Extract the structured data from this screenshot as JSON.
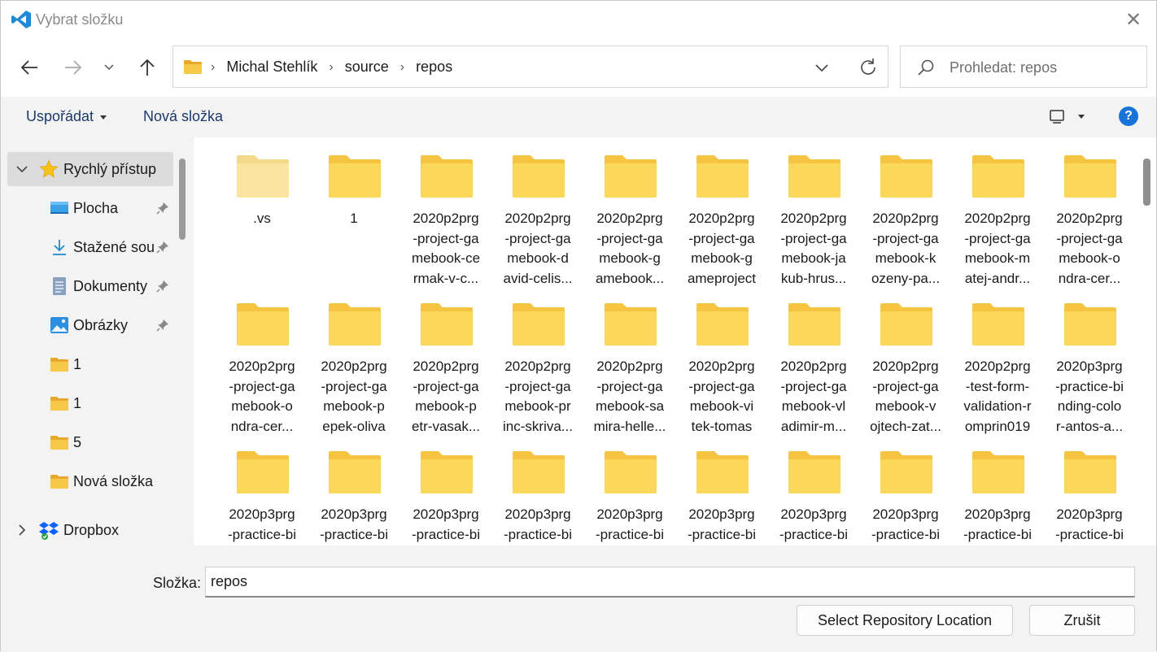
{
  "window": {
    "title": "Vybrat složku",
    "close_label": "✕"
  },
  "nav": {
    "breadcrumbs": [
      "Michal Stehlík",
      "source",
      "repos"
    ],
    "search_placeholder": "Prohledat: repos"
  },
  "toolbar": {
    "organize_label": "Uspořádat",
    "new_folder_label": "Nová složka",
    "help_label": "?"
  },
  "sidebar": {
    "items": [
      {
        "label": "Rychlý přístup",
        "icon": "star-icon",
        "pinned": false
      },
      {
        "label": "Plocha",
        "icon": "desktop-icon",
        "pinned": true
      },
      {
        "label": "Stažené soubory",
        "icon": "download-icon",
        "pinned": true
      },
      {
        "label": "Dokumenty",
        "icon": "document-icon",
        "pinned": true
      },
      {
        "label": "Obrázky",
        "icon": "pictures-icon",
        "pinned": true
      },
      {
        "label": "1",
        "icon": "folder-icon",
        "pinned": false
      },
      {
        "label": "1",
        "icon": "folder-icon",
        "pinned": false
      },
      {
        "label": "5",
        "icon": "folder-icon",
        "pinned": false
      },
      {
        "label": "Nová složka",
        "icon": "folder-icon",
        "pinned": false
      },
      {
        "label": "Dropbox",
        "icon": "dropbox-icon",
        "pinned": false
      }
    ]
  },
  "folders": [
    {
      "name": ".vs",
      "faded": true
    },
    {
      "name": "1"
    },
    {
      "name": "2020p2prg\n-project-ga\nmebook-ce\nrmak-v-c..."
    },
    {
      "name": "2020p2prg\n-project-ga\nmebook-d\navid-celis..."
    },
    {
      "name": "2020p2prg\n-project-ga\nmebook-g\namebook..."
    },
    {
      "name": "2020p2prg\n-project-ga\nmebook-g\nameproject"
    },
    {
      "name": "2020p2prg\n-project-ga\nmebook-ja\nkub-hrus..."
    },
    {
      "name": "2020p2prg\n-project-ga\nmebook-k\nozeny-pa..."
    },
    {
      "name": "2020p2prg\n-project-ga\nmebook-m\natej-andr..."
    },
    {
      "name": "2020p2prg\n-project-ga\nmebook-o\nndra-cer..."
    },
    {
      "name": "2020p2prg\n-project-ga\nmebook-o\nndra-cer..."
    },
    {
      "name": "2020p2prg\n-project-ga\nmebook-p\nepek-oliva"
    },
    {
      "name": "2020p2prg\n-project-ga\nmebook-p\netr-vasak..."
    },
    {
      "name": "2020p2prg\n-project-ga\nmebook-pr\ninc-skriva..."
    },
    {
      "name": "2020p2prg\n-project-ga\nmebook-sa\nmira-helle..."
    },
    {
      "name": "2020p2prg\n-project-ga\nmebook-vi\ntek-tomas"
    },
    {
      "name": "2020p2prg\n-project-ga\nmebook-vl\nadimir-m..."
    },
    {
      "name": "2020p2prg\n-project-ga\nmebook-v\nojtech-zat..."
    },
    {
      "name": "2020p2prg\n-test-form-\nvalidation-r\nomprin019"
    },
    {
      "name": "2020p3prg\n-practice-bi\nnding-colo\nr-antos-a..."
    },
    {
      "name": "2020p3prg\n-practice-bi"
    },
    {
      "name": "2020p3prg\n-practice-bi"
    },
    {
      "name": "2020p3prg\n-practice-bi"
    },
    {
      "name": "2020p3prg\n-practice-bi"
    },
    {
      "name": "2020p3prg\n-practice-bi"
    },
    {
      "name": "2020p3prg\n-practice-bi"
    },
    {
      "name": "2020p3prg\n-practice-bi"
    },
    {
      "name": "2020p3prg\n-practice-bi"
    },
    {
      "name": "2020p3prg\n-practice-bi"
    },
    {
      "name": "2020p3prg\n-practice-bi"
    }
  ],
  "bottom": {
    "folder_label": "Složka:",
    "folder_value": "repos",
    "select_label": "Select Repository Location",
    "cancel_label": "Zrušit"
  },
  "colors": {
    "accent": "#1a73d9",
    "folder": "#f5c542",
    "folder_light": "#fbe3a0"
  }
}
